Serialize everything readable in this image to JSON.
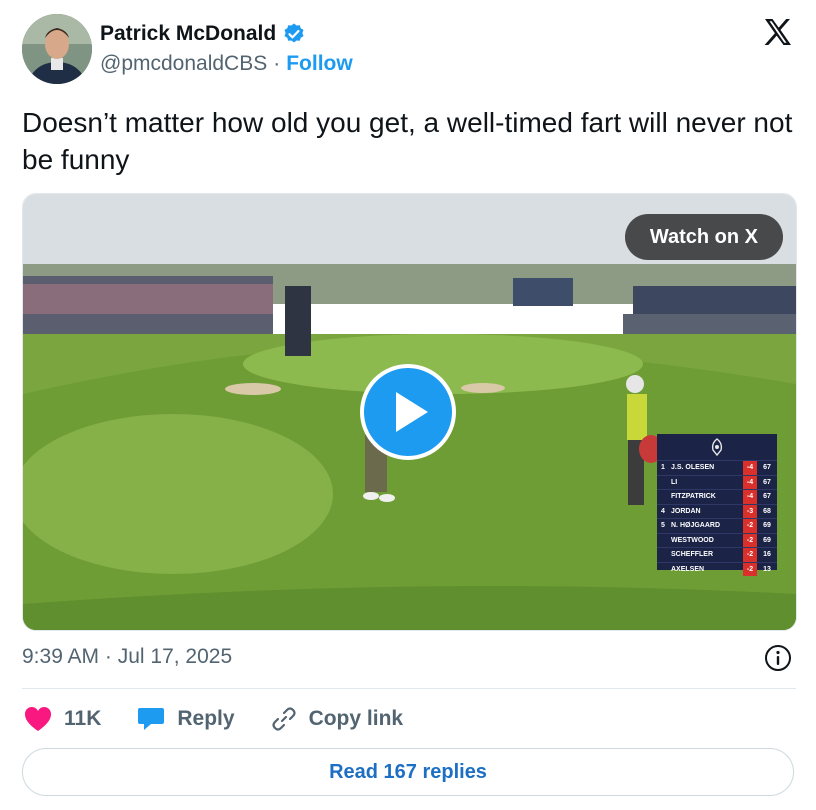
{
  "author": {
    "name": "Patrick McDonald",
    "handle": "@pmcdonaldCBS",
    "separator": "·",
    "follow_label": "Follow"
  },
  "tweet": {
    "text": "Doesn’t matter how old you get, a well-timed fart will never not be funny",
    "timestamp": "9:39 AM · Jul 17, 2025"
  },
  "media": {
    "watch_label": "Watch on X",
    "leaderboard": [
      {
        "pos": "1",
        "name": "J.S. OLESEN",
        "score": "-4",
        "thru": "67"
      },
      {
        "pos": "",
        "name": "LI",
        "score": "-4",
        "thru": "67"
      },
      {
        "pos": "",
        "name": "FITZPATRICK",
        "score": "-4",
        "thru": "67"
      },
      {
        "pos": "4",
        "name": "JORDAN",
        "score": "-3",
        "thru": "68"
      },
      {
        "pos": "5",
        "name": "N. HØJGAARD",
        "score": "-2",
        "thru": "69"
      },
      {
        "pos": "",
        "name": "WESTWOOD",
        "score": "-2",
        "thru": "69"
      },
      {
        "pos": "",
        "name": "SCHEFFLER",
        "score": "-2",
        "thru": "16"
      },
      {
        "pos": "",
        "name": "AXELSEN",
        "score": "-2",
        "thru": "13"
      }
    ]
  },
  "actions": {
    "like_count": "11K",
    "reply_label": "Reply",
    "copy_label": "Copy link"
  },
  "read_replies_label": "Read 167 replies",
  "colors": {
    "accent": "#1d9bf0",
    "like": "#f91880",
    "muted": "#536471"
  }
}
